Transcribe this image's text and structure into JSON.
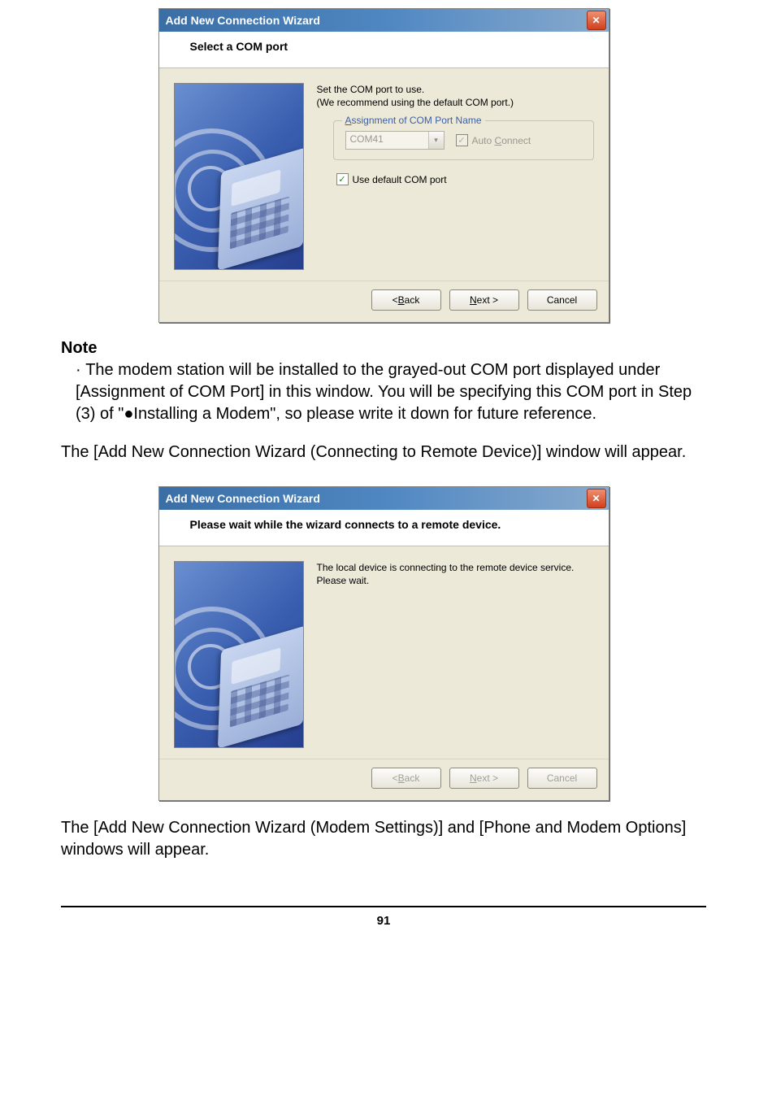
{
  "dialog1": {
    "title": "Add New Connection Wizard",
    "header": "Select a COM port",
    "instr1": "Set the COM port to use.",
    "instr2": "(We recommend using the default COM port.)",
    "legend": "Assignment of COM Port Name",
    "combo_value": "COM41",
    "auto_connect": "Auto Connect",
    "use_default": "Use default COM port",
    "back": "< Back",
    "next": "Next >",
    "cancel": "Cancel"
  },
  "dialog2": {
    "title": "Add New Connection Wizard",
    "header": "Please wait while the wizard connects to a remote device.",
    "line1": "The local device is connecting to the remote device service.",
    "line2": "Please wait.",
    "back": "< Back",
    "next": "Next >",
    "cancel": "Cancel"
  },
  "note_heading": "Note",
  "note_body": "The modem station will be installed to the grayed-out COM port displayed under [Assignment of COM Port] in this window. You will be specifying this COM port in Step (3) of \"●Installing a Modem\", so please write it down for future reference.",
  "para_mid": "The [Add New Connection Wizard (Connecting to Remote Device)] window will appear.",
  "para_end": "The [Add New Connection Wizard (Modem Settings)] and [Phone and Modem Options] windows will appear.",
  "page_number": "91"
}
